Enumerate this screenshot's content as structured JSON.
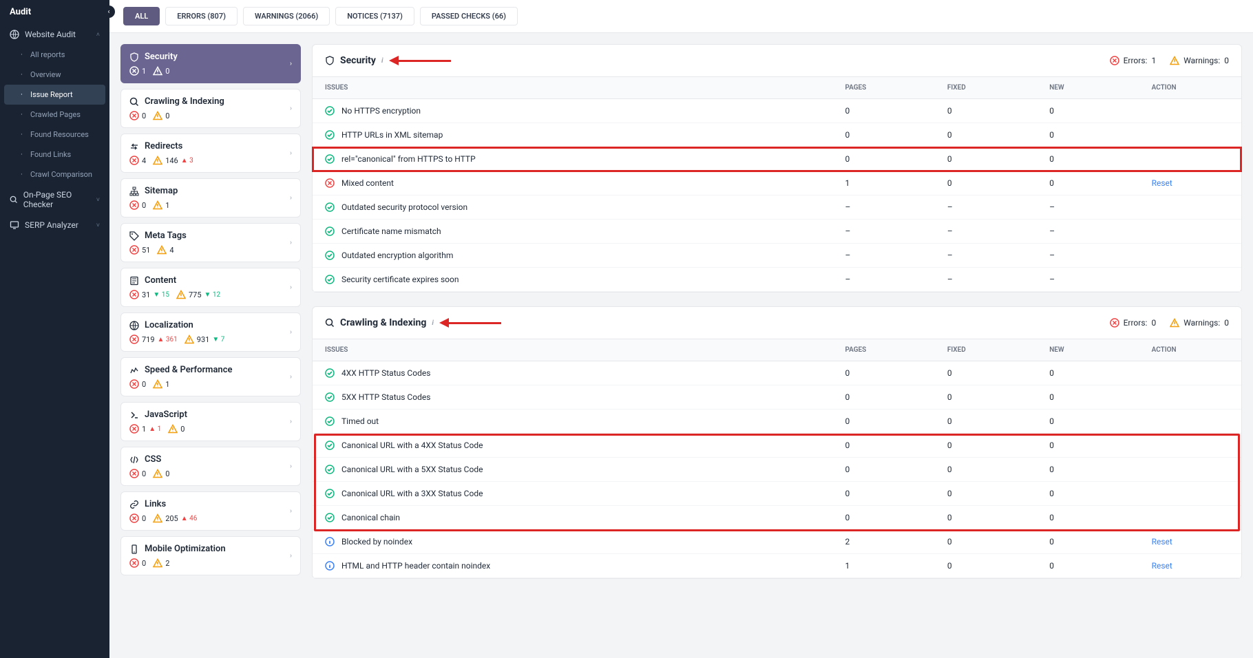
{
  "sidebar": {
    "title": "Audit",
    "sections": [
      {
        "label": "Website Audit",
        "icon": "globe",
        "expanded": true,
        "items": [
          {
            "label": "All reports"
          },
          {
            "label": "Overview"
          },
          {
            "label": "Issue Report",
            "active": true
          },
          {
            "label": "Crawled Pages"
          },
          {
            "label": "Found Resources"
          },
          {
            "label": "Found Links"
          },
          {
            "label": "Crawl Comparison"
          }
        ]
      },
      {
        "label": "On-Page SEO Checker",
        "icon": "search"
      },
      {
        "label": "SERP Analyzer",
        "icon": "screen"
      }
    ]
  },
  "tabs": [
    {
      "label": "ALL",
      "active": true
    },
    {
      "label": "ERRORS (807)"
    },
    {
      "label": "WARNINGS (2066)"
    },
    {
      "label": "NOTICES (7137)"
    },
    {
      "label": "PASSED CHECKS (66)"
    }
  ],
  "categories": [
    {
      "icon": "shield",
      "label": "Security",
      "errors": "1",
      "warnings": "0",
      "active": true
    },
    {
      "icon": "search",
      "label": "Crawling & Indexing",
      "errors": "0",
      "warnings": "0"
    },
    {
      "icon": "redirect",
      "label": "Redirects",
      "errors": "4",
      "warnings": "146",
      "warn_delta": "▲ 3"
    },
    {
      "icon": "sitemap",
      "label": "Sitemap",
      "errors": "0",
      "warnings": "1"
    },
    {
      "icon": "tag",
      "label": "Meta Tags",
      "errors": "51",
      "warnings": "4"
    },
    {
      "icon": "content",
      "label": "Content",
      "errors": "31",
      "err_delta": "▼ 15",
      "warnings": "775",
      "warn_delta": "▼ 12"
    },
    {
      "icon": "globe",
      "label": "Localization",
      "errors": "719",
      "err_delta": "▲ 361",
      "warnings": "931",
      "warn_delta": "▼ 7"
    },
    {
      "icon": "speed",
      "label": "Speed & Performance",
      "errors": "0",
      "warnings": "1"
    },
    {
      "icon": "js",
      "label": "JavaScript",
      "errors": "1",
      "err_delta": "▲ 1",
      "warnings": "0"
    },
    {
      "icon": "css",
      "label": "CSS",
      "errors": "0",
      "warnings": "0"
    },
    {
      "icon": "link",
      "label": "Links",
      "errors": "0",
      "warnings": "205",
      "warn_delta": "▲ 46"
    },
    {
      "icon": "mobile",
      "label": "Mobile Optimization",
      "errors": "0",
      "warnings": "2"
    }
  ],
  "blocks": [
    {
      "title": "Security",
      "icon": "shield",
      "errors_label": "Errors:",
      "errors": "1",
      "warnings_label": "Warnings:",
      "warnings": "0",
      "arrow": true,
      "cols": {
        "issues": "ISSUES",
        "pages": "PAGES",
        "fixed": "FIXED",
        "new": "NEW",
        "action": "ACTION"
      },
      "rows": [
        {
          "status": "ok",
          "label": "No HTTPS encryption",
          "pages": "0",
          "fixed": "0",
          "new": "0"
        },
        {
          "status": "ok",
          "label": "HTTP URLs in XML sitemap",
          "pages": "0",
          "fixed": "0",
          "new": "0"
        },
        {
          "status": "ok",
          "label": "rel=\"canonical\" from HTTPS to HTTP",
          "pages": "0",
          "fixed": "0",
          "new": "0",
          "highlight": true
        },
        {
          "status": "err",
          "label": "Mixed content",
          "pages": "1",
          "fixed": "0",
          "new": "0",
          "action": "Reset"
        },
        {
          "status": "ok",
          "label": "Outdated security protocol version",
          "pages": "–",
          "fixed": "–",
          "new": "–"
        },
        {
          "status": "ok",
          "label": "Certificate name mismatch",
          "pages": "–",
          "fixed": "–",
          "new": "–"
        },
        {
          "status": "ok",
          "label": "Outdated encryption algorithm",
          "pages": "–",
          "fixed": "–",
          "new": "–"
        },
        {
          "status": "ok",
          "label": "Security certificate expires soon",
          "pages": "–",
          "fixed": "–",
          "new": "–"
        }
      ]
    },
    {
      "title": "Crawling & Indexing",
      "icon": "search",
      "errors_label": "Errors:",
      "errors": "0",
      "warnings_label": "Warnings:",
      "warnings": "0",
      "arrow": true,
      "cols": {
        "issues": "ISSUES",
        "pages": "PAGES",
        "fixed": "FIXED",
        "new": "NEW",
        "action": "ACTION"
      },
      "highlight_range": [
        3,
        6
      ],
      "rows": [
        {
          "status": "ok",
          "label": "4XX HTTP Status Codes",
          "pages": "0",
          "fixed": "0",
          "new": "0"
        },
        {
          "status": "ok",
          "label": "5XX HTTP Status Codes",
          "pages": "0",
          "fixed": "0",
          "new": "0"
        },
        {
          "status": "ok",
          "label": "Timed out",
          "pages": "0",
          "fixed": "0",
          "new": "0"
        },
        {
          "status": "ok",
          "label": "Canonical URL with a 4XX Status Code",
          "pages": "0",
          "fixed": "0",
          "new": "0"
        },
        {
          "status": "ok",
          "label": "Canonical URL with a 5XX Status Code",
          "pages": "0",
          "fixed": "0",
          "new": "0"
        },
        {
          "status": "ok",
          "label": "Canonical URL with a 3XX Status Code",
          "pages": "0",
          "fixed": "0",
          "new": "0"
        },
        {
          "status": "ok",
          "label": "Canonical chain",
          "pages": "0",
          "fixed": "0",
          "new": "0"
        },
        {
          "status": "info",
          "label": "Blocked by noindex",
          "pages": "2",
          "fixed": "0",
          "new": "0",
          "action": "Reset"
        },
        {
          "status": "info",
          "label": "HTML and HTTP header contain noindex",
          "pages": "1",
          "fixed": "0",
          "new": "0",
          "action": "Reset"
        }
      ]
    }
  ]
}
